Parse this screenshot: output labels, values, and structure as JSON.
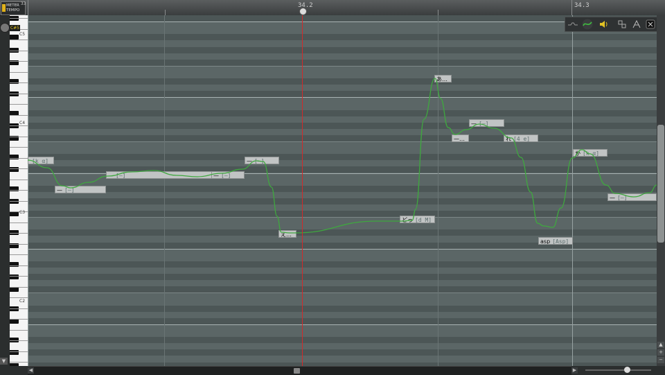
{
  "app": {
    "meter_tempo_line1": "METER",
    "meter_tempo_line2": "TEMPO"
  },
  "ruler": {
    "left_label": "33",
    "playhead_label": "34.2",
    "marker_label": "34.3"
  },
  "piano": {
    "c5_box": "C#5",
    "octave_labels": [
      "C5",
      "C4",
      "C3",
      "C2"
    ]
  },
  "notes": [
    {
      "lyric": "",
      "phoneme": "[k α]"
    },
    {
      "lyric": "—",
      "phoneme": "[—]"
    },
    {
      "lyric": "—",
      "phoneme": "[—]"
    },
    {
      "lyric": "—",
      "phoneme": "[—]"
    },
    {
      "lyric": "—",
      "phoneme": "[—]"
    },
    {
      "lyric": "え…",
      "phoneme": ""
    },
    {
      "lyric": "どっ",
      "phoneme": "[d M]"
    },
    {
      "lyric": "あ…",
      "phoneme": ""
    },
    {
      "lyric": "—…",
      "phoneme": ""
    },
    {
      "lyric": "—",
      "phoneme": "[—]"
    },
    {
      "lyric": "れ",
      "phoneme": "[4 e]"
    },
    {
      "lyric": "asp",
      "phoneme": "[Asp]"
    },
    {
      "lyric": "か",
      "phoneme": "[k α]"
    },
    {
      "lyric": "—",
      "phoneme": "[—]"
    }
  ],
  "toolbar": {
    "icons": [
      "pitch-line-icon",
      "pitch-curve-icon",
      "speaker-icon",
      "grid-snap-icon",
      "edit-mode-icon",
      "lock-icon"
    ]
  },
  "colors": {
    "playhead": "#d22a2a",
    "pitch_curve": "#3fa83f",
    "note_fill": "#c1c4c4",
    "octave_marker": "#e6c21a"
  }
}
